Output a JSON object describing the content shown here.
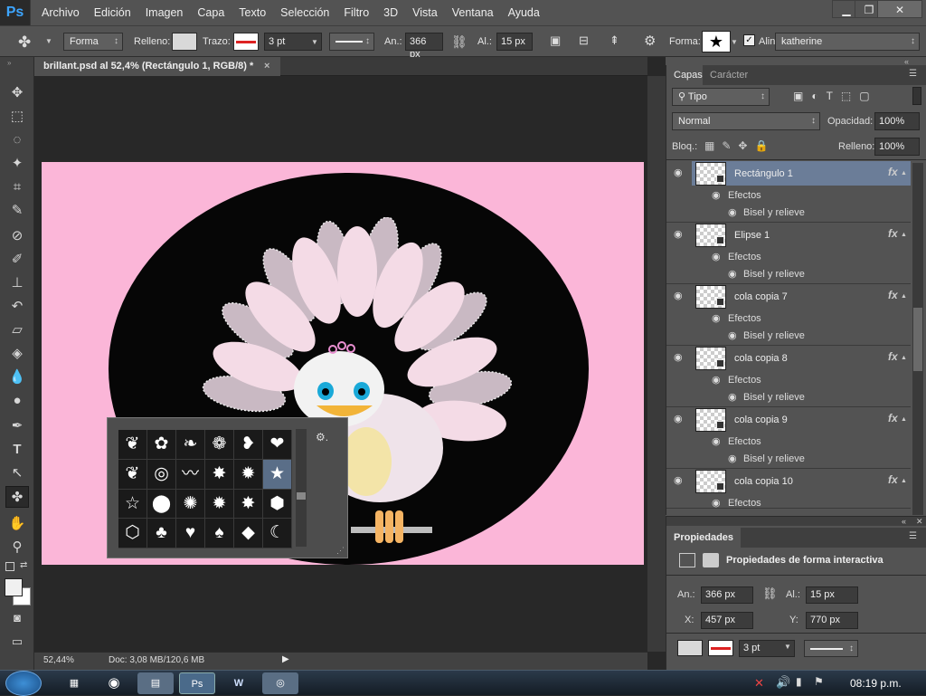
{
  "app": {
    "logo": "Ps"
  },
  "menu": [
    "Archivo",
    "Edición",
    "Imagen",
    "Capa",
    "Texto",
    "Selección",
    "Filtro",
    "3D",
    "Vista",
    "Ventana",
    "Ayuda"
  ],
  "window_buttons": {
    "minimize": "▁",
    "restore": "❐",
    "close": "✕"
  },
  "options_bar": {
    "tool_mode": "Forma",
    "fill_label": "Relleno:",
    "stroke_label": "Trazo:",
    "stroke_width": "3 pt",
    "width_label": "An.:",
    "width_value": "366 px",
    "height_label": "Al.:",
    "height_value": "15 px",
    "shape_label": "Forma:",
    "align_label": "Alin",
    "preset_value": "katherine"
  },
  "document": {
    "tab_title": "brillant.psd al 52,4% (Rectángulo 1, RGB/8) *",
    "tab_close": "×",
    "zoom": "52,44%",
    "doc_info": "Doc: 3,08 MB/120,6 MB",
    "canvas_color": "#fbb6d8"
  },
  "shape_picker": {
    "shapes": [
      "❦",
      "✿",
      "❧",
      "❁",
      "❥",
      "❤",
      "❦",
      "◎",
      "〰",
      "✸",
      "✹",
      "★",
      "☆",
      "⬤",
      "✺",
      "✹",
      "✸",
      "⬢",
      "⬡",
      "♣",
      "♥",
      "♠",
      "◆",
      "☾"
    ],
    "gear": "⚙."
  },
  "layers_panel": {
    "tabs": [
      "Capas",
      "Carácter"
    ],
    "filter_label": "Tipo",
    "blend_mode": "Normal",
    "opacity_label": "Opacidad:",
    "opacity_value": "100%",
    "lock_label": "Bloq.:",
    "fill_label": "Relleno:",
    "fill_value": "100%",
    "layers": [
      {
        "name": "Rectángulo 1",
        "effects": "Efectos",
        "effect": "Bisel y relieve",
        "selected": true
      },
      {
        "name": "Elipse 1",
        "effects": "Efectos",
        "effect": "Bisel y relieve",
        "selected": false
      },
      {
        "name": "cola copia 7",
        "effects": "Efectos",
        "effect": "Bisel y relieve",
        "selected": false
      },
      {
        "name": "cola copia 8",
        "effects": "Efectos",
        "effect": "Bisel y relieve",
        "selected": false
      },
      {
        "name": "cola copia 9",
        "effects": "Efectos",
        "effect": "Bisel y relieve",
        "selected": false
      },
      {
        "name": "cola copia 10",
        "effects": "Efectos",
        "effect": "",
        "selected": false
      }
    ]
  },
  "properties_panel": {
    "title": "Propiedades",
    "subtitle": "Propiedades de forma interactiva",
    "w_label": "An.:",
    "w_value": "366 px",
    "h_label": "Al.:",
    "h_value": "15 px",
    "x_label": "X:",
    "x_value": "457 px",
    "y_label": "Y:",
    "y_value": "770 px",
    "stroke_width": "3 pt"
  },
  "taskbar": {
    "clock": "08:19 p.m."
  }
}
